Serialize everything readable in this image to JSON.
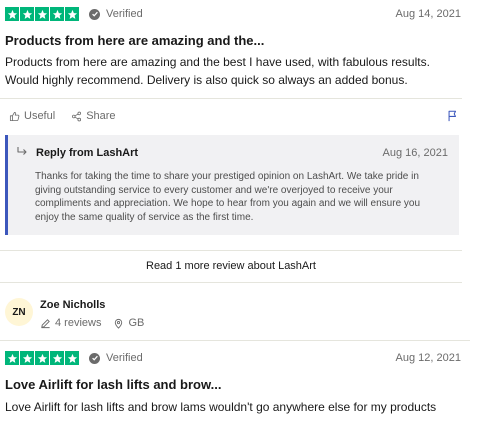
{
  "colors": {
    "star_green": "#00b67a",
    "accent_blue": "#3c57bc",
    "reply_bg": "#f1f1f3",
    "avatar_bg": "#fff6d6"
  },
  "review1": {
    "rating": 5,
    "verified": "Verified",
    "date": "Aug 14, 2021",
    "title": "Products from here are amazing and the...",
    "body": "Products from here are amazing and the best I have used, with fabulous results. Would highly recommend. Delivery is also quick so always an added bonus.",
    "useful_label": "Useful",
    "share_label": "Share",
    "icons": {
      "useful": "thumbs-up-icon",
      "share": "share-icon",
      "flag": "flag-icon"
    },
    "reply": {
      "title": "Reply from LashArt",
      "date": "Aug 16, 2021",
      "body": "Thanks for taking the time to share your prestiged opinion on LashArt. We take pride in giving outstanding service to every customer and we're overjoyed to receive your compliments and appreciation. We hope to hear from you again and we will ensure you enjoy the same quality of service as the first time."
    }
  },
  "read_more": "Read 1 more review about LashArt",
  "reviewer": {
    "initials": "ZN",
    "name": "Zoe Nicholls",
    "reviews": "4 reviews",
    "country": "GB"
  },
  "review2": {
    "rating": 5,
    "verified": "Verified",
    "date": "Aug 12, 2021",
    "title": "Love Airlift for lash lifts and brow...",
    "body": "Love Airlift for lash lifts and brow lams wouldn't go anywhere else for my products"
  }
}
